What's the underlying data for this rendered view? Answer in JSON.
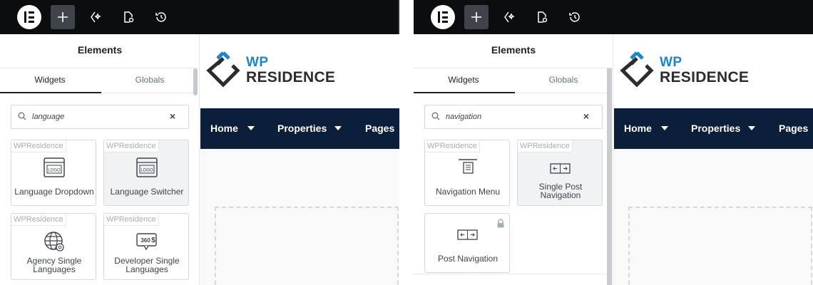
{
  "panels": [
    {
      "id": "left",
      "toolbar": {
        "logo_icon": "elementor-logo-icon",
        "buttons": [
          {
            "name": "add-element-button",
            "icon": "plus-icon",
            "active": true
          },
          {
            "name": "ai-button",
            "icon": "sparkle-icon",
            "active": false
          },
          {
            "name": "page-settings-button",
            "icon": "page-settings-icon",
            "active": false
          },
          {
            "name": "history-button",
            "icon": "history-icon",
            "active": false
          }
        ]
      },
      "sidebar": {
        "title": "Elements",
        "tabs": [
          {
            "label": "Widgets",
            "active": true
          },
          {
            "label": "Globals",
            "active": false
          }
        ],
        "search": {
          "value": "language",
          "clear_icon": "×"
        }
      },
      "widgets": [
        {
          "badge": "WPResidence",
          "label": "Language Dropdown",
          "icon": "logo-window-icon",
          "hover": false,
          "locked": false
        },
        {
          "badge": "WPResidence",
          "label": "Language Switcher",
          "icon": "logo-window-icon",
          "hover": true,
          "locked": false
        },
        {
          "badge": "WPResidence",
          "label": "Agency Single Languages",
          "icon": "globe-gear-icon",
          "hover": false,
          "locked": false
        },
        {
          "badge": "WPResidence",
          "label": "Developer Single Languages",
          "icon": "price-360-icon",
          "hover": false,
          "locked": false
        }
      ]
    },
    {
      "id": "right",
      "toolbar": {
        "logo_icon": "elementor-logo-icon",
        "buttons": [
          {
            "name": "add-element-button",
            "icon": "plus-icon",
            "active": true
          },
          {
            "name": "ai-button",
            "icon": "sparkle-icon",
            "active": false
          },
          {
            "name": "page-settings-button",
            "icon": "page-settings-icon",
            "active": false
          },
          {
            "name": "history-button",
            "icon": "history-icon",
            "active": false
          }
        ]
      },
      "sidebar": {
        "title": "Elements",
        "tabs": [
          {
            "label": "Widgets",
            "active": true
          },
          {
            "label": "Globals",
            "active": false
          }
        ],
        "search": {
          "value": "navigation",
          "clear_icon": "×"
        }
      },
      "widgets": [
        {
          "badge": "WPResidence",
          "label": "Navigation Menu",
          "icon": "nav-menu-icon",
          "hover": false,
          "locked": false
        },
        {
          "badge": "WPResidence",
          "label": "Single Post Navigation",
          "icon": "post-nav-icon",
          "hover": true,
          "locked": false
        },
        {
          "badge": "",
          "label": "Post Navigation",
          "icon": "post-nav-icon",
          "hover": false,
          "locked": true
        }
      ]
    }
  ],
  "site": {
    "brand_top": "WP",
    "brand_bottom": "RESIDENCE",
    "nav": [
      "Home",
      "Properties",
      "Pages"
    ]
  },
  "colors": {
    "topbar": "#0c0d0e",
    "navbar": "#0c1f3a",
    "brand_blue": "#1a86d0",
    "active_button": "#3f444b"
  }
}
